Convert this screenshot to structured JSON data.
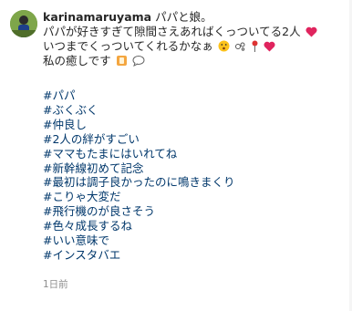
{
  "post": {
    "username": "karinamaruyama",
    "caption_lines": [
      "パパと娘。",
      "パパが好きすぎて隙間さえあればくっついてる2人",
      "いつまでくっついてくれるかなぁ",
      "私の癒しです"
    ],
    "hashtags": [
      "#パパ",
      "#ぶくぶく",
      "#仲良し",
      "#2人の絆がすごい",
      "#ママもたまにはいれてね",
      "#新幹線初めて記念",
      "#最初は調子良かったのに鳴きまくり",
      "#こりゃ大変だ",
      "#飛行機のが良さそう",
      "#色々成長するね",
      "#いい意味で",
      "#インスタバエ"
    ],
    "timestamp": "1日前"
  },
  "icons": {
    "line2": [
      "red-heart-icon"
    ],
    "line3": [
      "hushed-face-icon",
      "bubble-icon",
      "pin-icon",
      "red-heart-icon"
    ],
    "line4": [
      "baby-bottle-icon",
      "speech-balloon-icon"
    ]
  },
  "colors": {
    "hashtag": "#00376b",
    "text": "#262626",
    "muted": "#8e8e8e",
    "heart": "#e0245e"
  }
}
